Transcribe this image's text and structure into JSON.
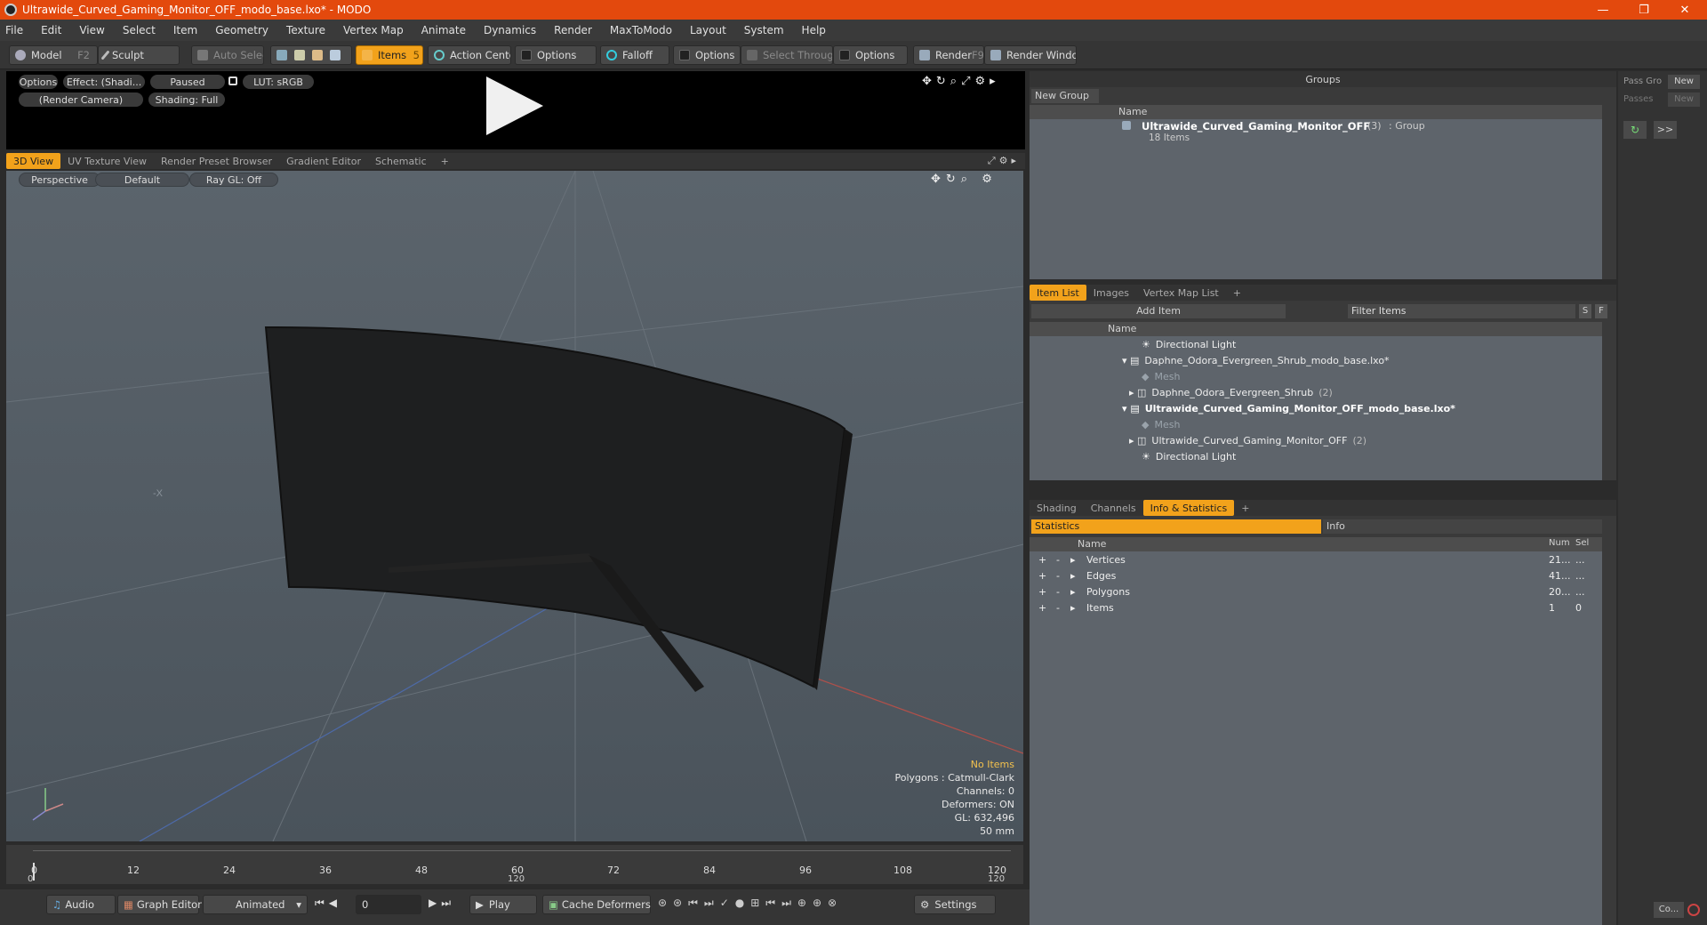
{
  "window": {
    "title": "Ultrawide_Curved_Gaming_Monitor_OFF_modo_base.lxo* - MODO",
    "min": "—",
    "max": "❐",
    "close": "✕"
  },
  "menu": [
    "File",
    "Edit",
    "View",
    "Select",
    "Item",
    "Geometry",
    "Texture",
    "Vertex Map",
    "Animate",
    "Dynamics",
    "Render",
    "MaxToModo",
    "Layout",
    "System",
    "Help"
  ],
  "toolbar": {
    "model": "Model",
    "model_key": "F2",
    "sculpt": "Sculpt",
    "auto_select": "Auto Select",
    "items": "Items",
    "items_key": "5",
    "action_center": "Action Center",
    "options1": "Options",
    "falloff": "Falloff",
    "options2": "Options",
    "select_through": "Select Through",
    "options3": "Options",
    "render": "Render",
    "render_key": "F9",
    "render_window": "Render Window"
  },
  "preview": {
    "options": "Options",
    "effect": "Effect: (Shadi...",
    "paused": "Paused",
    "lut": "LUT: sRGB",
    "camera": "(Render Camera)",
    "shading": "Shading: Full"
  },
  "view_tabs": [
    "3D View",
    "UV Texture View",
    "Render Preset Browser",
    "Gradient Editor",
    "Schematic",
    "+"
  ],
  "viewport": {
    "perspective": "Perspective",
    "default": "Default",
    "raygl": "Ray GL: Off",
    "axis_label": "-X",
    "overlay": {
      "no_items": "No Items",
      "polygons": "Polygons : Catmull-Clark",
      "channels": "Channels: 0",
      "deformers": "Deformers: ON",
      "gl": "GL: 632,496",
      "focal": "50 mm"
    }
  },
  "timeline": {
    "ticks": [
      "0",
      "12",
      "24",
      "36",
      "48",
      "60",
      "72",
      "84",
      "96",
      "108",
      "120"
    ],
    "sub": [
      "0",
      "120",
      "120"
    ]
  },
  "bottom": {
    "audio": "Audio",
    "graph_editor": "Graph Editor",
    "animated": "Animated",
    "frame": "0",
    "play": "Play",
    "cache": "Cache Deformers",
    "settings": "Settings"
  },
  "groups": {
    "title": "Groups",
    "new_group": "New Group",
    "col_name": "Name",
    "item_name": "Ultrawide_Curved_Gaming_Monitor_OFF",
    "item_count": "(3)",
    "item_type": ": Group",
    "item_sub": "18 Items"
  },
  "item_list": {
    "tabs": [
      "Item List",
      "Images",
      "Vertex Map List",
      "+"
    ],
    "add_item": "Add Item",
    "filter": "Filter Items",
    "s": "S",
    "f": "F",
    "col_name": "Name",
    "rows": [
      "Directional Light",
      "Daphne_Odora_Evergreen_Shrub_modo_base.lxo*",
      "Mesh",
      "Daphne_Odora_Evergreen_Shrub",
      "Ultrawide_Curved_Gaming_Monitor_OFF_modo_base.lxo*",
      "Mesh",
      "Ultrawide_Curved_Gaming_Monitor_OFF",
      "Directional Light"
    ],
    "counts": {
      "shrub": "(2)",
      "monitor": "(2)"
    }
  },
  "info": {
    "tabs": [
      "Shading",
      "Channels",
      "Info & Statistics",
      "+"
    ],
    "statistics": "Statistics",
    "info": "Info",
    "cols": [
      "Name",
      "Num",
      "Sel"
    ],
    "rows": [
      {
        "name": "Vertices",
        "num": "21...",
        "sel": "..."
      },
      {
        "name": "Edges",
        "num": "41...",
        "sel": "..."
      },
      {
        "name": "Polygons",
        "num": "20...",
        "sel": "..."
      },
      {
        "name": "Items",
        "num": "1",
        "sel": "0"
      }
    ]
  },
  "far": {
    "pass_group": "Pass Gro",
    "passes": "Passes",
    "new": "New",
    "arrows": ">>",
    "co": "Co..."
  },
  "colors": {
    "accent": "#f2a21b",
    "titlebar": "#e3490d"
  }
}
